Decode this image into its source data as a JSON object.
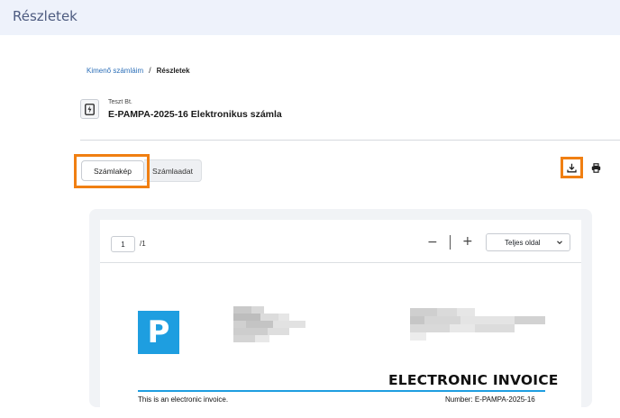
{
  "header": {
    "title": "Részletek"
  },
  "breadcrumb": {
    "parent": "Kimenő számláim",
    "separator": "/",
    "current": "Részletek"
  },
  "document": {
    "company": "Teszt Bt.",
    "title": "E-PAMPA-2025-16 Elektronikus számla"
  },
  "tabs": [
    {
      "label": "Számlakép",
      "active": true
    },
    {
      "label": "Számlaadat",
      "active": false
    }
  ],
  "actions": {
    "download_icon": "download-icon",
    "print_icon": "printer-icon"
  },
  "viewer": {
    "page_current": "1",
    "page_total": "/1",
    "zoom_out": "−",
    "zoom_in": "+",
    "zoom_mode": "Teljes oldal"
  },
  "invoice": {
    "logo_letter": "P",
    "heading": "ELECTRONIC INVOICE",
    "note": "This is an electronic invoice.",
    "number": "Number: E-PAMPA-2025-16"
  },
  "colors": {
    "accent": "#1e9ee0",
    "highlight": "#f07f12",
    "topbar": "#eef2fb"
  }
}
